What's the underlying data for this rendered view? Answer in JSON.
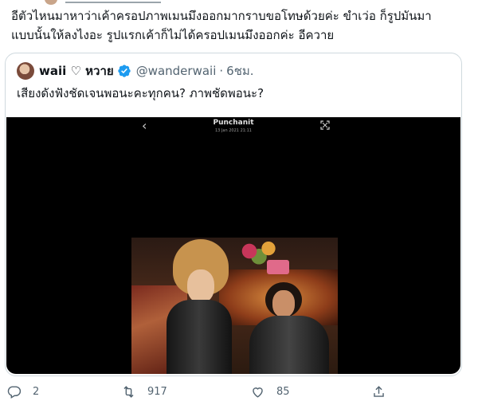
{
  "tweet": {
    "text": "อีตัวไหนมาหาว่าเค้าครอปภาพเมนมึงออกมากราบขอโทษด้วยค่ะ ขำเว่อ ก็รูปมันมา\nแบบนั้นให้ลงไงอะ รูปแรกเค้าก็ไม่ได้ครอปเมนมึงออกค่ะ อีควาย"
  },
  "quoted": {
    "display_name": "waii ♡ หวาย",
    "handle": "@wanderwaii",
    "separator": "·",
    "time": "6ชม.",
    "text": "เสียงดังฟังชัดเจนพอนะคะทุกคน? ภาพชัดพอนะ?",
    "media": {
      "title": "Punchanit",
      "date": "13 Jan 2021 21:11"
    }
  },
  "actions": {
    "reply_count": "2",
    "retweet_count": "917",
    "like_count": "85"
  },
  "colors": {
    "verified": "#1d9bf0",
    "muted": "#536471",
    "border": "#cfd9de"
  }
}
